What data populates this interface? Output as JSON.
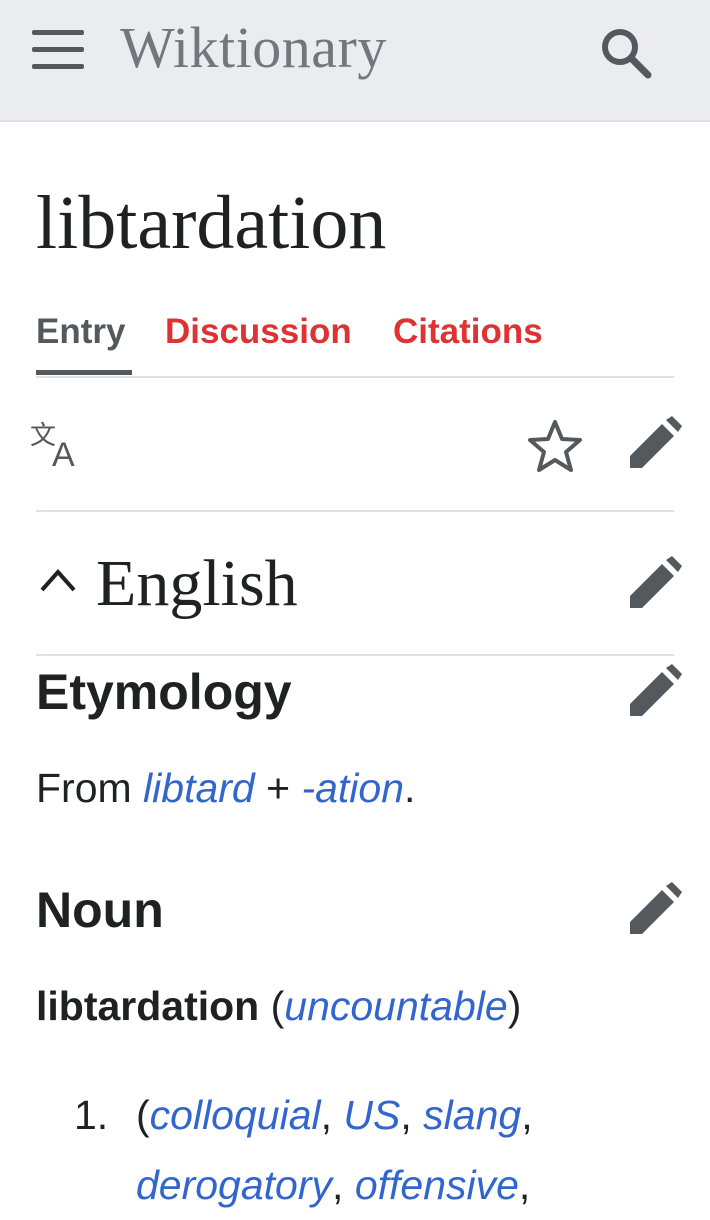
{
  "header": {
    "site_title": "Wiktionary"
  },
  "page": {
    "title": "libtardation"
  },
  "tabs": [
    {
      "label": "Entry",
      "active": true
    },
    {
      "label": "Discussion",
      "active": false
    },
    {
      "label": "Citations",
      "active": false
    }
  ],
  "toolbar": {
    "icons": [
      "translate-icon",
      "star-icon",
      "edit-icon"
    ]
  },
  "language_section": {
    "heading": "English"
  },
  "etymology": {
    "heading": "Etymology",
    "text_prefix": "From ",
    "link1": "libtard",
    "joiner": " + ",
    "link2": "-ation",
    "suffix": "."
  },
  "noun": {
    "heading": "Noun",
    "headword": "libtardation",
    "open_paren": " (",
    "qualifier": "uncountable",
    "close_paren": ")"
  },
  "definition": {
    "number": "1.",
    "open": "(",
    "labels": [
      "colloquial",
      "US",
      "slang",
      "derogatory",
      "offensive"
    ],
    "sep": ", "
  },
  "colors": {
    "link": "#3366cc",
    "tab_inactive": "#dd3333",
    "header_bg": "#eaecf0"
  }
}
